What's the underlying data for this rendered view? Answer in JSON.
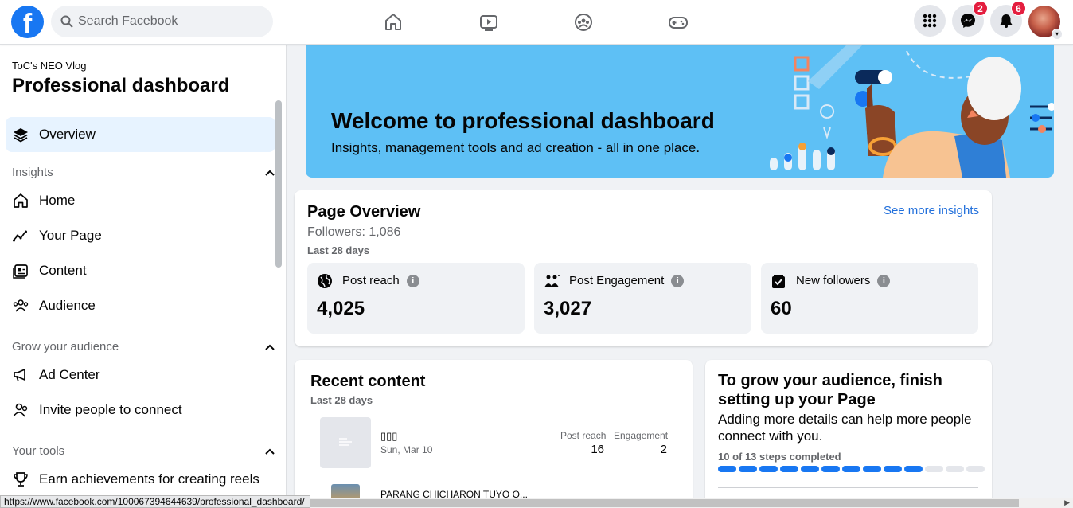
{
  "topbar": {
    "logo_letter": "f",
    "search_placeholder": "Search Facebook",
    "messenger_badge": "2",
    "notifications_badge": "6"
  },
  "sidebar": {
    "page_name": "ToC's NEO Vlog",
    "title": "Professional dashboard",
    "overview": "Overview",
    "sections": {
      "insights": "Insights",
      "grow": "Grow your audience",
      "tools": "Your tools"
    },
    "insights_items": [
      "Home",
      "Your Page",
      "Content",
      "Audience"
    ],
    "grow_items": [
      "Ad Center",
      "Invite people to connect"
    ],
    "tools_items": [
      "Earn achievements for creating reels"
    ]
  },
  "banner": {
    "title": "Welcome to professional dashboard",
    "subtitle": "Insights, management tools and ad creation - all in one place."
  },
  "page_overview": {
    "title": "Page Overview",
    "followers": "Followers: 1,086",
    "period": "Last 28 days",
    "link": "See more insights",
    "stats": [
      {
        "label": "Post reach",
        "value": "4,025"
      },
      {
        "label": "Post Engagement",
        "value": "3,027"
      },
      {
        "label": "New followers",
        "value": "60"
      }
    ]
  },
  "recent_content": {
    "title": "Recent content",
    "period": "Last 28 days",
    "posts": [
      {
        "title": "▯▯▯",
        "date": "Sun, Mar 10",
        "reach_label": "Post reach",
        "reach": "16",
        "engagement_label": "Engagement",
        "engagement": "2"
      },
      {
        "title": "PARANG CHICHARON TUYO O..."
      }
    ]
  },
  "grow_card": {
    "title": "To grow your audience, finish setting up your Page",
    "subtitle": "Adding more details can help more people connect with you.",
    "steps_text": "10 of 13 steps completed",
    "steps_done": 10,
    "steps_total": 13
  },
  "statusbar": {
    "url": "https://www.facebook.com/100067394644639/professional_dashboard/"
  },
  "colors": {
    "brand": "#1877f2",
    "banner": "#5ec0f5",
    "link": "#216fdb",
    "badge": "#e41e3f",
    "active_nav": "#e7f3ff"
  }
}
